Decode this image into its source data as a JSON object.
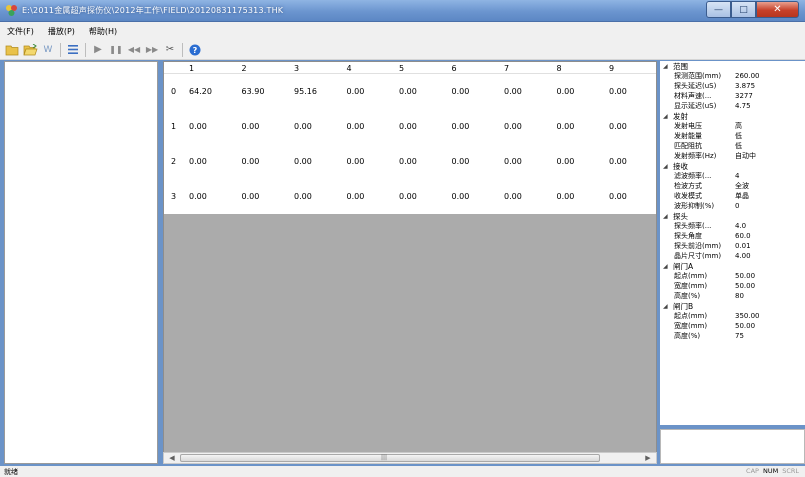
{
  "window": {
    "title": "E:\\2011金属超声探伤仪\\2012年工作\\FIELD\\20120831175313.THK",
    "controls": [
      "minimize",
      "maximize",
      "close"
    ]
  },
  "menu": [
    {
      "label": "文件(F)"
    },
    {
      "label": "播放(P)"
    },
    {
      "label": "帮助(H)"
    }
  ],
  "toolbar": {
    "icons": [
      "new-folder-icon",
      "open-folder-icon",
      "waveform-icon",
      "list-icon",
      "play-icon",
      "pause-icon",
      "skip-back-icon",
      "skip-forward-icon",
      "cut-icon",
      "help-icon"
    ]
  },
  "grid": {
    "columns": [
      "1",
      "2",
      "3",
      "4",
      "5",
      "6",
      "7",
      "8",
      "9"
    ],
    "rows": [
      {
        "index": "0",
        "values": [
          "64.20",
          "63.90",
          "95.16",
          "0.00",
          "0.00",
          "0.00",
          "0.00",
          "0.00",
          "0.00"
        ]
      },
      {
        "index": "1",
        "values": [
          "0.00",
          "0.00",
          "0.00",
          "0.00",
          "0.00",
          "0.00",
          "0.00",
          "0.00",
          "0.00"
        ]
      },
      {
        "index": "2",
        "values": [
          "0.00",
          "0.00",
          "0.00",
          "0.00",
          "0.00",
          "0.00",
          "0.00",
          "0.00",
          "0.00"
        ]
      },
      {
        "index": "3",
        "values": [
          "0.00",
          "0.00",
          "0.00",
          "0.00",
          "0.00",
          "0.00",
          "0.00",
          "0.00",
          "0.00"
        ]
      }
    ]
  },
  "properties": [
    {
      "category": "范围",
      "items": [
        {
          "name": "探测范围(mm)",
          "value": "260.00"
        },
        {
          "name": "探头延迟(uS)",
          "value": "3.875"
        },
        {
          "name": "材料声速(...",
          "value": "3277"
        },
        {
          "name": "显示延迟(uS)",
          "value": "4.75"
        }
      ]
    },
    {
      "category": "发射",
      "items": [
        {
          "name": "发射电压",
          "value": "高"
        },
        {
          "name": "发射能量",
          "value": "低"
        },
        {
          "name": "匹配阻抗",
          "value": "低"
        },
        {
          "name": "发射频率(Hz)",
          "value": "自动中"
        }
      ]
    },
    {
      "category": "接收",
      "items": [
        {
          "name": "滤波频率(...",
          "value": "4"
        },
        {
          "name": "检波方式",
          "value": "全波"
        },
        {
          "name": "收发模式",
          "value": "单晶"
        },
        {
          "name": "波形抑制(%)",
          "value": "0"
        }
      ]
    },
    {
      "category": "探头",
      "items": [
        {
          "name": "探头频率(...",
          "value": "4.0"
        },
        {
          "name": "探头角度",
          "value": "60.0"
        },
        {
          "name": "探头前沿(mm)",
          "value": "0.01"
        },
        {
          "name": "晶片尺寸(mm)",
          "value": "4.00"
        }
      ]
    },
    {
      "category": "闸门A",
      "items": [
        {
          "name": "起点(mm)",
          "value": "50.00"
        },
        {
          "name": "宽度(mm)",
          "value": "50.00"
        },
        {
          "name": "高度(%)",
          "value": "80"
        }
      ]
    },
    {
      "category": "闸门B",
      "items": [
        {
          "name": "起点(mm)",
          "value": "350.00"
        },
        {
          "name": "宽度(mm)",
          "value": "50.00"
        },
        {
          "name": "高度(%)",
          "value": "75"
        }
      ]
    }
  ],
  "status": {
    "text": "就绪",
    "indicators": [
      {
        "label": "CAP",
        "active": false
      },
      {
        "label": "NUM",
        "active": true
      },
      {
        "label": "SCRL",
        "active": false
      }
    ]
  }
}
